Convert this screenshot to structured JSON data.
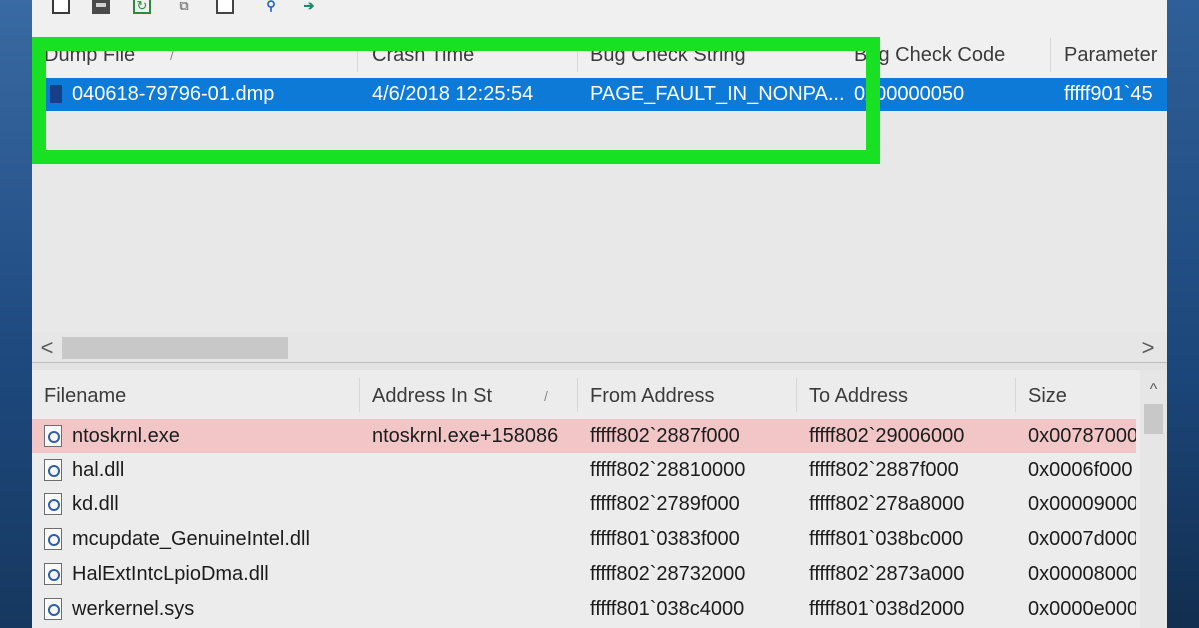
{
  "toolbar": {
    "icons": [
      "open-icon",
      "save-icon",
      "refresh-icon",
      "copy-icon",
      "properties-icon",
      "find-icon",
      "exit-icon"
    ]
  },
  "dump_list": {
    "columns": [
      "Dump File",
      "Crash Time",
      "Bug Check String",
      "Bug Check Code",
      "Parameter"
    ],
    "sort_glyph": "/",
    "rows": [
      {
        "file": "040618-79796-01.dmp",
        "crash_time": "4/6/2018 12:25:54",
        "bug_check_string": "PAGE_FAULT_IN_NONPA...",
        "bug_check_code": "0x00000050",
        "parameter": "fffff901`45"
      }
    ]
  },
  "scrollbar": {
    "left_arrow": "<",
    "right_arrow": ">"
  },
  "modules_list": {
    "columns": [
      "Filename",
      "Address In St",
      "From Address",
      "To Address",
      "Size"
    ],
    "sort_glyph": "/",
    "scroll_up": "^",
    "rows": [
      {
        "filename": "ntoskrnl.exe",
        "address_in_stack": "ntoskrnl.exe+158086",
        "from": "fffff802`2887f000",
        "to": "fffff802`29006000",
        "size": "0x00787000",
        "highlighted": true
      },
      {
        "filename": "hal.dll",
        "address_in_stack": "",
        "from": "fffff802`28810000",
        "to": "fffff802`2887f000",
        "size": "0x0006f000",
        "highlighted": false
      },
      {
        "filename": "kd.dll",
        "address_in_stack": "",
        "from": "fffff802`2789f000",
        "to": "fffff802`278a8000",
        "size": "0x00009000",
        "highlighted": false
      },
      {
        "filename": "mcupdate_GenuineIntel.dll",
        "address_in_stack": "",
        "from": "fffff801`0383f000",
        "to": "fffff801`038bc000",
        "size": "0x0007d000",
        "highlighted": false
      },
      {
        "filename": "HalExtIntcLpioDma.dll",
        "address_in_stack": "",
        "from": "fffff802`28732000",
        "to": "fffff802`2873a000",
        "size": "0x00008000",
        "highlighted": false
      },
      {
        "filename": "werkernel.sys",
        "address_in_stack": "",
        "from": "fffff801`038c4000",
        "to": "fffff801`038d2000",
        "size": "0x0000e000",
        "highlighted": false
      }
    ]
  },
  "colors": {
    "selection": "#0d7ad8",
    "highlight_box": "#18e023",
    "row_highlight": "#f2c6c6",
    "desktop": "#1f4f86"
  }
}
